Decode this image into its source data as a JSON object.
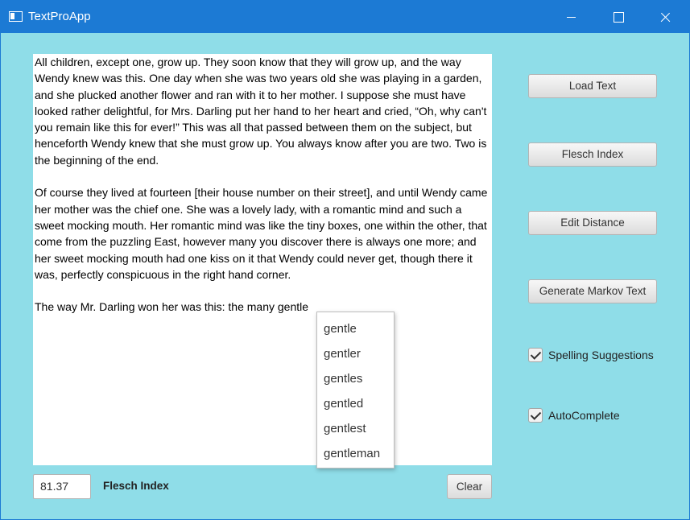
{
  "window": {
    "title": "TextProApp"
  },
  "editor": {
    "paragraphs": [
      "All children, except one, grow up. They soon know that they will grow up, and the way Wendy knew was this. One day when she was two years old she was playing in a garden, and she plucked another flower and ran with it to her mother. I suppose she must have looked rather delightful, for Mrs. Darling put her hand to her heart and cried, “Oh, why can't you remain like this for ever!” This was all that passed between them on the subject, but henceforth Wendy knew that she must grow up. You always know after you are two. Two is the beginning of the end.",
      "Of course they lived at fourteen [their house number on their street], and until Wendy came her mother was the chief one. She was a lovely lady, with a romantic mind and such a sweet mocking mouth. Her romantic mind was like the tiny boxes, one within the other, that come from the puzzling East, however many you discover there is always one more; and her sweet mocking mouth had one kiss on it that Wendy could never get, though there it was, perfectly conspicuous in the right hand corner.",
      "The way Mr. Darling won her was this: the many gentle"
    ]
  },
  "autocomplete": {
    "options": [
      "gentle",
      "gentler",
      "gentles",
      "gentled",
      "gentlest",
      "gentleman"
    ]
  },
  "sidebar": {
    "load_text": "Load Text",
    "flesch_index": "Flesch Index",
    "edit_distance": "Edit Distance",
    "generate_markov": "Generate Markov Text",
    "spelling_suggestions": {
      "label": "Spelling Suggestions",
      "checked": true
    },
    "autocomplete": {
      "label": "AutoComplete",
      "checked": true
    }
  },
  "footer": {
    "flesch_value": "81.37",
    "flesch_label": "Flesch Index",
    "clear_label": "Clear"
  }
}
